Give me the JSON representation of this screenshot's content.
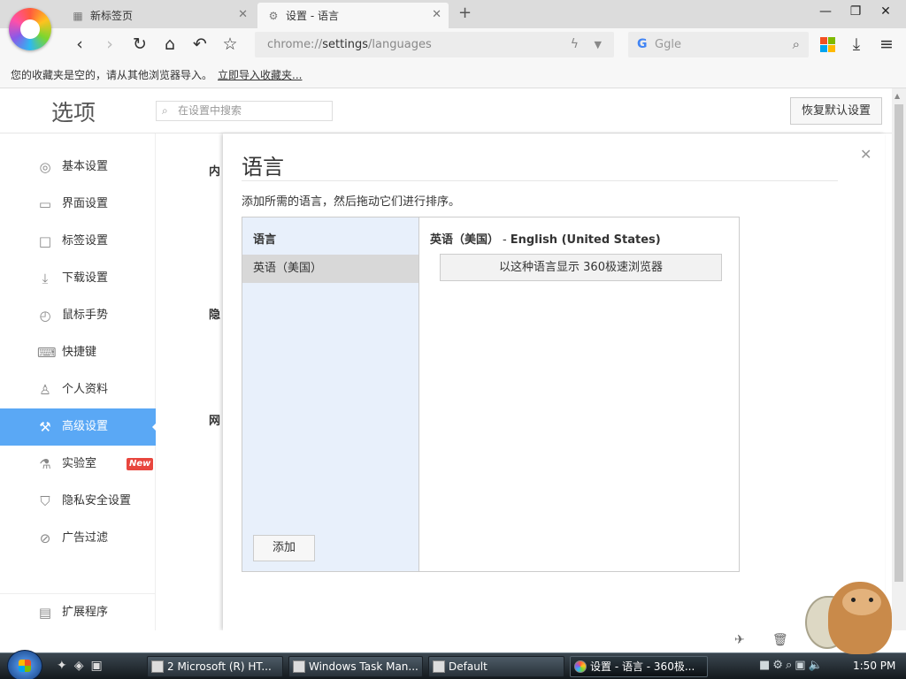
{
  "browser": {
    "tabs": [
      {
        "title": "新标签页",
        "icon": "newtab-grid-icon"
      },
      {
        "title": "设置 - 语言",
        "icon": "gear-icon"
      }
    ],
    "address": {
      "prefix": "chrome://",
      "host": "settings",
      "path": "/languages"
    },
    "search_placeholder": "Ggle",
    "bookmark_bar": {
      "message": "您的收藏夹是空的，请从其他浏览器导入。",
      "link": "立即导入收藏夹..."
    }
  },
  "settings": {
    "title": "选项",
    "search_placeholder": "在设置中搜索",
    "restore_button": "恢复默认设置",
    "sidebar": {
      "items": [
        {
          "label": "基本设置",
          "icon": "target-icon"
        },
        {
          "label": "界面设置",
          "icon": "window-icon"
        },
        {
          "label": "标签设置",
          "icon": "tab-icon"
        },
        {
          "label": "下载设置",
          "icon": "download-icon"
        },
        {
          "label": "鼠标手势",
          "icon": "mouse-icon"
        },
        {
          "label": "快捷键",
          "icon": "keyboard-icon"
        },
        {
          "label": "个人资料",
          "icon": "person-icon"
        },
        {
          "label": "高级设置",
          "icon": "wrench-icon",
          "active": true
        },
        {
          "label": "实验室",
          "icon": "flask-icon",
          "badge": "New"
        },
        {
          "label": "隐私安全设置",
          "icon": "shield-icon"
        },
        {
          "label": "广告过滤",
          "icon": "block-icon"
        },
        {
          "label": "扩展程序",
          "icon": "extension-icon"
        }
      ]
    },
    "background_headings": [
      "内",
      "隐",
      "网"
    ]
  },
  "dialog": {
    "title": "语言",
    "description": "添加所需的语言，然后拖动它们进行排序。",
    "list_header": "语言",
    "languages": [
      "英语（美国）"
    ],
    "add_button": "添加",
    "detail": {
      "native_name": "英语（美国）",
      "separator": "-",
      "english_name": "English (United States)",
      "display_button": "以这种语言显示 360极速浏览器"
    }
  },
  "taskbar": {
    "items": [
      {
        "label": "2 Microsoft (R) HT..."
      },
      {
        "label": "Windows Task Man..."
      },
      {
        "label": "Default"
      },
      {
        "label": "设置 - 语言 - 360极...",
        "active": true
      }
    ],
    "clock": "1:50 PM"
  },
  "colors": {
    "accent": "#5aa8f5",
    "badge": "#e8463e"
  }
}
